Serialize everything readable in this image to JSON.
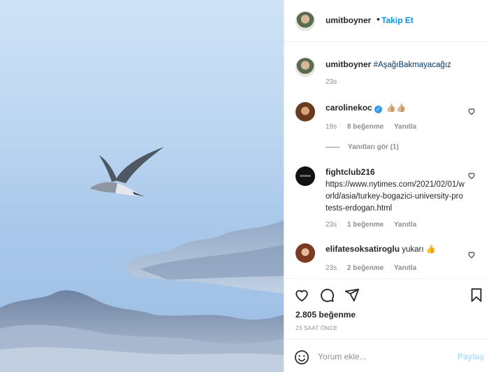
{
  "header": {
    "username": "umitboyner",
    "separator": "•",
    "follow_label": "Takip Et"
  },
  "caption": {
    "username": "umitboyner",
    "hashtag": "#AşağıBakmayacağız",
    "time": "23s"
  },
  "comments": [
    {
      "username": "carolinekoc",
      "verified": true,
      "text": "👍🏼👍🏼",
      "time": "19s",
      "likes": "8 beğenme",
      "reply": "Yanıtla",
      "view_replies": "Yanıtları gör (1)"
    },
    {
      "username": "fightclub216",
      "text": "https://www.nytimes.com/2021/02/01/world/asia/turkey-bogazici-university-protests-erdogan.html",
      "time": "23s",
      "likes": "1 beğenme",
      "reply": "Yanıtla"
    },
    {
      "username": "elifatesoksatiroglu",
      "text": "yukarı 👍",
      "time": "23s",
      "likes": "2 beğenme",
      "reply": "Yanıtla"
    }
  ],
  "likes_count": "2.805 beğenme",
  "post_date": "23 SAAT ÖNCE",
  "comment_input": {
    "placeholder": "Yorum ekle...",
    "post_label": "Paylaş"
  }
}
